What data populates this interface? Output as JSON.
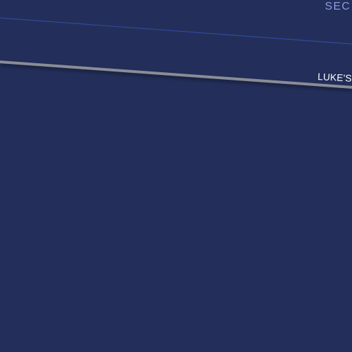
{
  "map": {
    "background_color": "#232f5a",
    "labels": {
      "district": "SEC",
      "road": "LUKE'S"
    },
    "colors": {
      "district_label": "#8e9be0",
      "road_label": "#ffffff",
      "road_stroke": "#8a8d96",
      "boundary_stroke": "#2f4a9e"
    }
  }
}
